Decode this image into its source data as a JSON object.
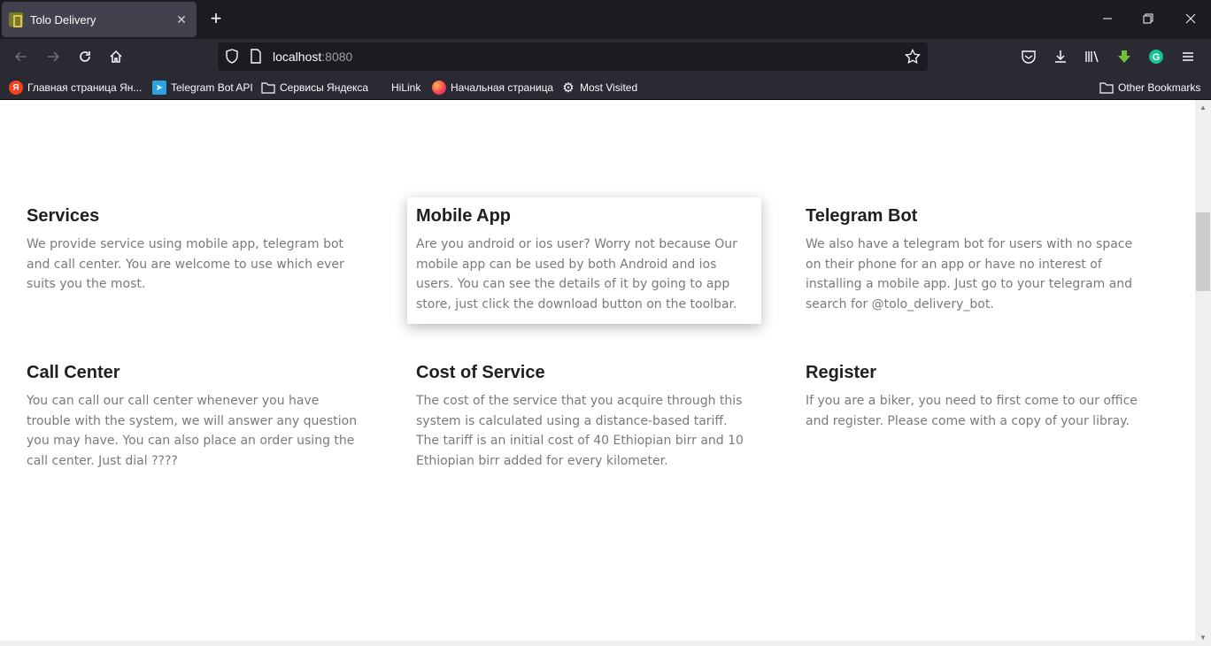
{
  "browser": {
    "tab": {
      "title": "Tolo Delivery",
      "close": "✕"
    },
    "newtab": "+",
    "window_controls": {
      "minimize": "—",
      "maximize": "❐",
      "close": "✕"
    },
    "url": {
      "host": "localhost",
      "port": ":8080"
    },
    "bookmarks": [
      {
        "label": "Главная страница Ян...",
        "icon": "yandex-icon"
      },
      {
        "label": "Telegram Bot API",
        "icon": "telegram-icon"
      },
      {
        "label": "Сервисы Яндекса",
        "icon": "folder-icon"
      },
      {
        "label": "HiLink",
        "icon": "none"
      },
      {
        "label": "Начальная страница",
        "icon": "firefox-icon"
      },
      {
        "label": "Most Visited",
        "icon": "gear-icon"
      }
    ],
    "other_bookmarks": "Other Bookmarks"
  },
  "cards": [
    {
      "title": "Services",
      "text": "We provide service using mobile app, telegram bot and call center. You are welcome to use which ever suits you the most."
    },
    {
      "title": "Mobile App",
      "text": "Are you android or ios user? Worry not because Our mobile app can be used by both Android and ios users. You can see the details of it by going to app store, just click the download button on the toolbar."
    },
    {
      "title": "Telegram Bot",
      "text": "We also have a telegram bot for users with no space on their phone for an app or have no interest of installing a mobile app. Just go to your telegram and search for @tolo_delivery_bot."
    },
    {
      "title": "Call Center",
      "text": "You can call our call center whenever you have trouble with the system, we will answer any question you may have. You can also place an order using the call center. Just dial ????"
    },
    {
      "title": "Cost of Service",
      "text": "The cost of the service that you acquire through this system is calculated using a distance-based tariff. The tariff is an initial cost of 40 Ethiopian birr and 10 Ethiopian birr added for every kilometer."
    },
    {
      "title": "Register",
      "text": "If you are a biker, you need to first come to our office and register. Please come with a copy of your libray."
    }
  ]
}
